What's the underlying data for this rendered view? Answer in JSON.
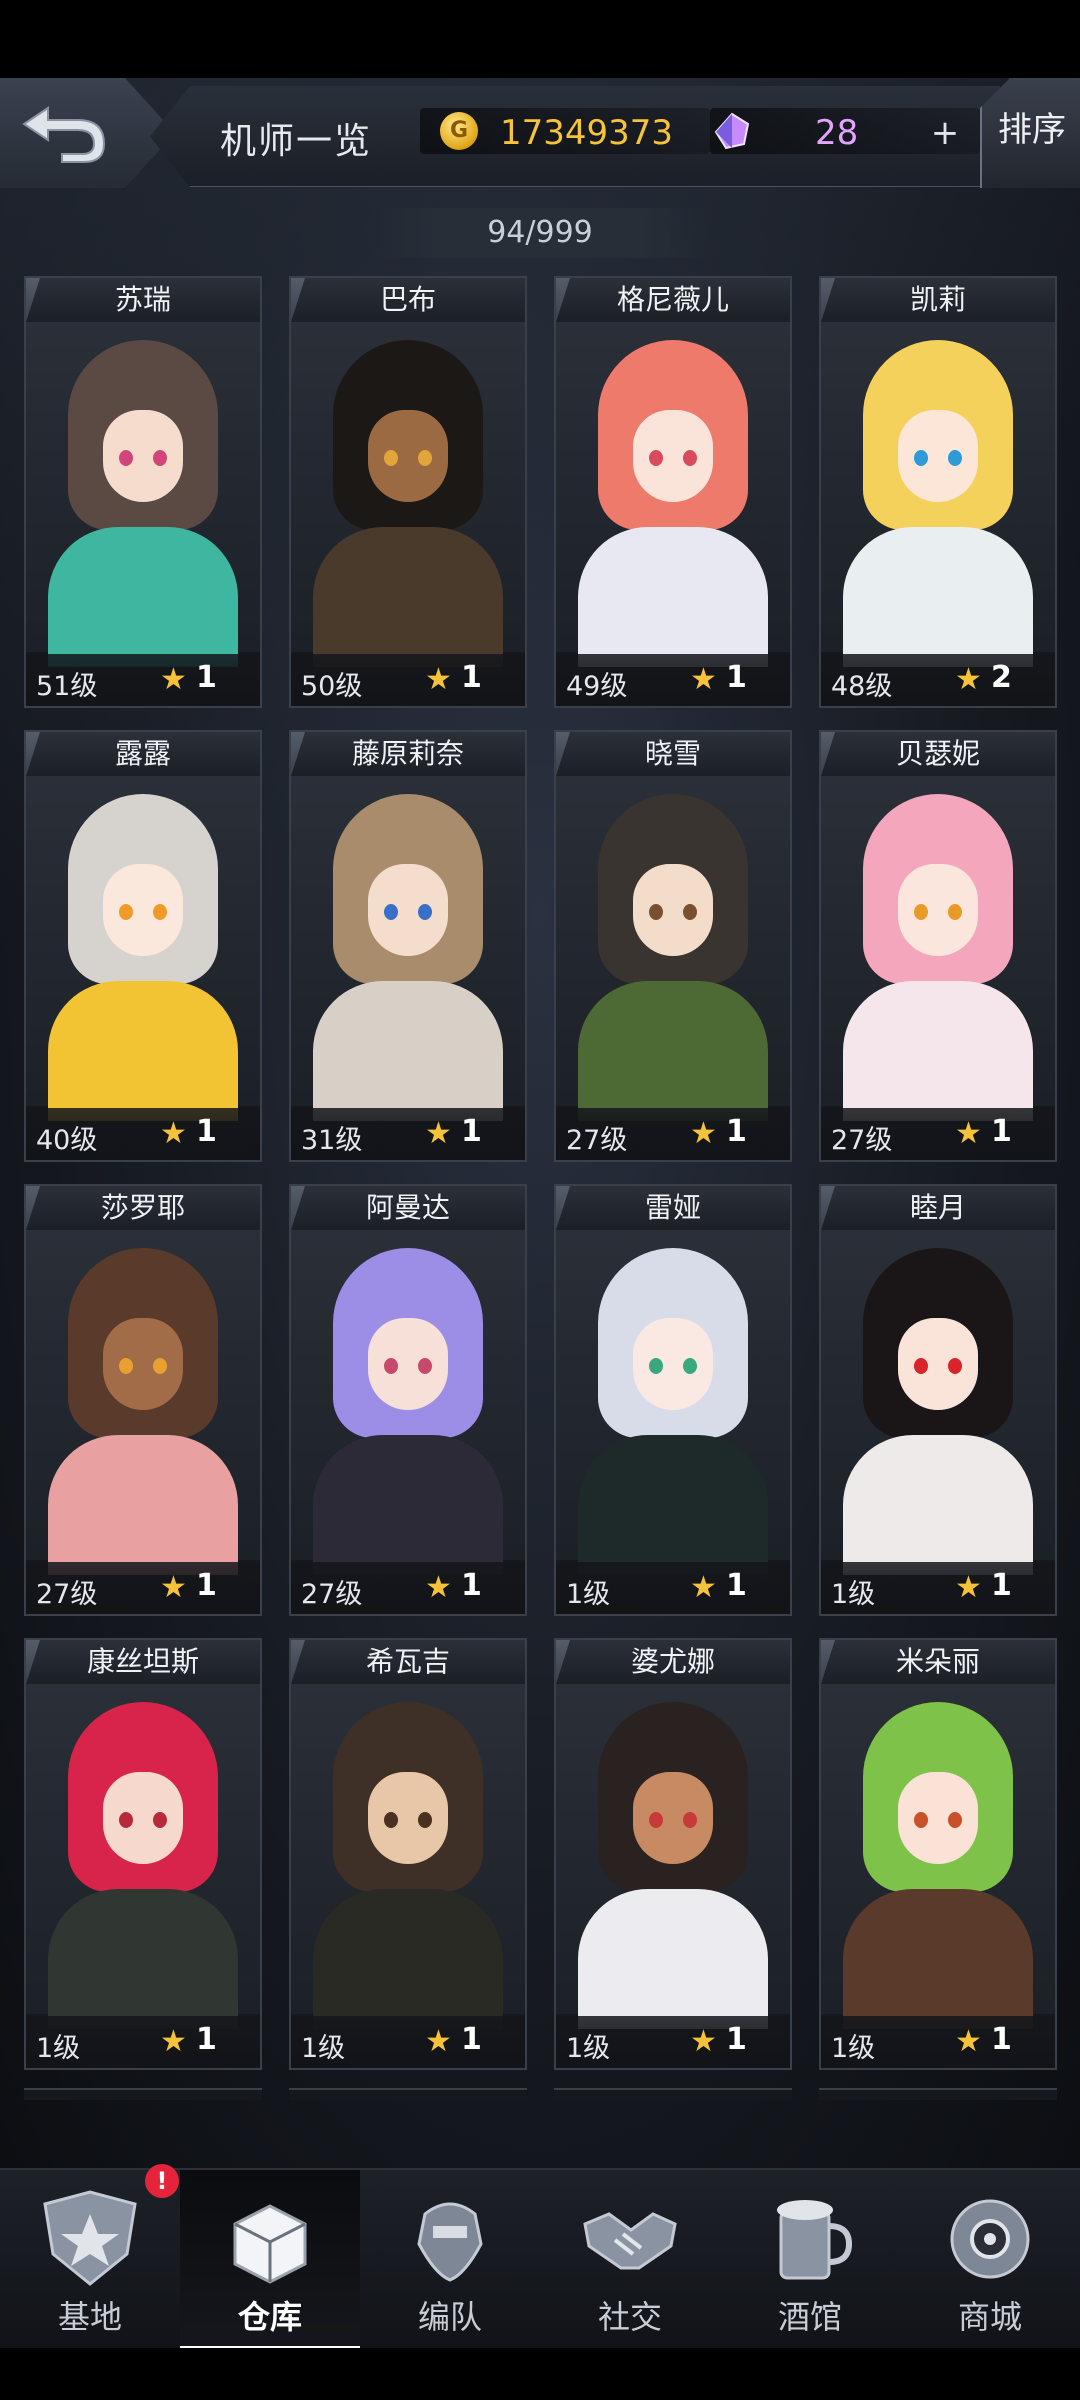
{
  "header": {
    "title": "机师一览",
    "coins": "17349373",
    "gems": "28",
    "plus_label": "+",
    "sort_label": "排序"
  },
  "roster_count": "94/999",
  "pilots": [
    {
      "name": "苏瑞",
      "level": "51级",
      "stars": "1",
      "hair": "#5b4a44",
      "skin": "#f6dccd",
      "eye": "#d2457a",
      "outfit": "#3fb6a0"
    },
    {
      "name": "巴布",
      "level": "50级",
      "stars": "1",
      "hair": "#1b1816",
      "skin": "#9c6a42",
      "eye": "#e0a63a",
      "outfit": "#4a3a2c"
    },
    {
      "name": "格尼薇儿",
      "level": "49级",
      "stars": "1",
      "hair": "#ee7a6c",
      "skin": "#fae3d8",
      "eye": "#d94a5a",
      "outfit": "#e8e8f2"
    },
    {
      "name": "凯莉",
      "level": "48级",
      "stars": "2",
      "hair": "#f4d15a",
      "skin": "#fbe6d8",
      "eye": "#2e9ad8",
      "outfit": "#e9eef0"
    },
    {
      "name": "露露",
      "level": "40级",
      "stars": "1",
      "hair": "#d6d3cf",
      "skin": "#fbe8dc",
      "eye": "#f09a2a",
      "outfit": "#f2c434"
    },
    {
      "name": "藤原莉奈",
      "level": "31级",
      "stars": "1",
      "hair": "#a88c6c",
      "skin": "#f5ddcd",
      "eye": "#3a6fc8",
      "outfit": "#d8cfc6"
    },
    {
      "name": "晓雪",
      "level": "27级",
      "stars": "1",
      "hair": "#3a3430",
      "skin": "#f4dccb",
      "eye": "#7a5030",
      "outfit": "#4e6a34"
    },
    {
      "name": "贝瑟妮",
      "level": "27级",
      "stars": "1",
      "hair": "#f4a6bd",
      "skin": "#fbe6dd",
      "eye": "#e89a28",
      "outfit": "#f4e6ea"
    },
    {
      "name": "莎罗耶",
      "level": "27级",
      "stars": "1",
      "hair": "#5a3a2a",
      "skin": "#a26c48",
      "eye": "#e8a030",
      "outfit": "#e8a0a0"
    },
    {
      "name": "阿曼达",
      "level": "27级",
      "stars": "1",
      "hair": "#9c8ee6",
      "skin": "#f6e0d8",
      "eye": "#c84a6a",
      "outfit": "#2c2a36"
    },
    {
      "name": "雷娅",
      "level": "1级",
      "stars": "1",
      "hair": "#d8dbe8",
      "skin": "#fae8e2",
      "eye": "#3aa87e",
      "outfit": "#1e2a2a"
    },
    {
      "name": "睦月",
      "level": "1级",
      "stars": "1",
      "hair": "#1a1618",
      "skin": "#fae4da",
      "eye": "#d8242a",
      "outfit": "#efeaea"
    },
    {
      "name": "康丝坦斯",
      "level": "1级",
      "stars": "1",
      "hair": "#d8244a",
      "skin": "#f6d8cc",
      "eye": "#b82a3a",
      "outfit": "#303632"
    },
    {
      "name": "希瓦吉",
      "level": "1级",
      "stars": "1",
      "hair": "#3e3026",
      "skin": "#e8c6a8",
      "eye": "#4a3020",
      "outfit": "#2a2a24"
    },
    {
      "name": "婆尤娜",
      "level": "1级",
      "stars": "1",
      "hair": "#2a2220",
      "skin": "#c88a62",
      "eye": "#c83a3a",
      "outfit": "#ececf0"
    },
    {
      "name": "米朵丽",
      "level": "1级",
      "stars": "1",
      "hair": "#7ec24a",
      "skin": "#fae2d6",
      "eye": "#c8502a",
      "outfit": "#5a3a2a"
    }
  ],
  "nav": [
    {
      "label": "基地",
      "icon": "base-icon",
      "active": false,
      "badge": "!"
    },
    {
      "label": "仓库",
      "icon": "warehouse-icon",
      "active": true
    },
    {
      "label": "编队",
      "icon": "formation-icon",
      "active": false
    },
    {
      "label": "社交",
      "icon": "social-handshake-icon",
      "active": false
    },
    {
      "label": "酒馆",
      "icon": "tavern-icon",
      "active": false
    },
    {
      "label": "商城",
      "icon": "shop-icon",
      "active": false
    }
  ],
  "colors": {
    "coin": "#f5c43a",
    "gem": "#e2a4ff",
    "star": "#f6c23a",
    "badge": "#e5243b"
  }
}
